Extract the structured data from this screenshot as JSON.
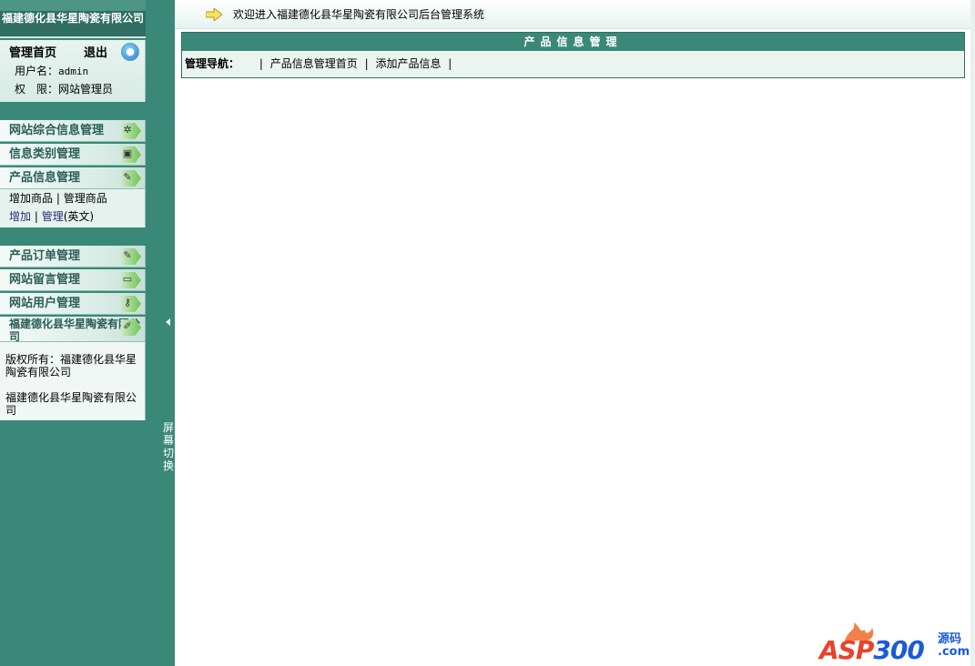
{
  "sidebar": {
    "site_title": "福建德化县华星陶瓷有限公司",
    "user": {
      "home_label": "管理首页",
      "logout_label": "退出",
      "username_label": "用户名：",
      "username": "admin",
      "role_label": "权　限：",
      "role": "网站管理员"
    },
    "menu": [
      {
        "label": "网站综合信息管理",
        "icon": "gear-icon"
      },
      {
        "label": "信息类别管理",
        "icon": "monitor-icon"
      },
      {
        "label": "产品信息管理",
        "icon": "document-pen-icon"
      },
      {
        "label": "产品订单管理",
        "icon": "document-pen-icon"
      },
      {
        "label": "网站留言管理",
        "icon": "folder-icon"
      },
      {
        "label": "网站用户管理",
        "icon": "key-icon"
      },
      {
        "label": "福建德化县华星陶瓷有限公司",
        "icon": "pen-icon"
      }
    ],
    "product_sub": {
      "add_goods": "增加商品",
      "manage_goods": "管理商品",
      "add": "增加",
      "manage": "管理",
      "english": "(英文)"
    },
    "copyright": {
      "line1": "版权所有：福建德化县华星陶瓷有限公司",
      "line2": "福建德化县华星陶瓷有限公司"
    },
    "toggle_label": "屏幕切换"
  },
  "topbar": {
    "welcome": "欢迎进入福建德化县华星陶瓷有限公司后台管理系统"
  },
  "main": {
    "section_title": "产品信息管理",
    "nav_label": "管理导航：",
    "nav_links": [
      "产品信息管理首页",
      "添加产品信息"
    ]
  },
  "watermark": {
    "brand_a": "ASP",
    "brand_b": "300",
    "suffix_1": "源码",
    "suffix_2": ".com"
  },
  "colors": {
    "sidebar_bg": "#3a8878",
    "header_bar": "#3a8878",
    "menu_text": "#2b5e58"
  }
}
